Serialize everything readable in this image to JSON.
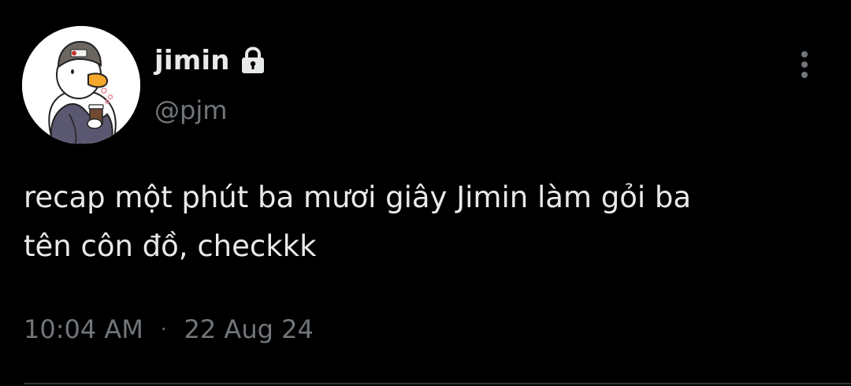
{
  "tweet": {
    "author": {
      "display_name": "jimin",
      "handle": "@pjm",
      "protected_icon": "lock-icon",
      "avatar_icon": "duck-avatar"
    },
    "text": "recap một phút ba mươi giây Jimin làm gỏi ba\ntên côn đồ, checkkk",
    "time": "10:04 AM",
    "separator": "·",
    "date": "22 Aug 24",
    "more_icon": "more-vertical-icon"
  },
  "colors": {
    "background": "#000000",
    "primary_text": "#e7e9ea",
    "secondary_text": "#71767b",
    "divider": "#2f3336"
  }
}
